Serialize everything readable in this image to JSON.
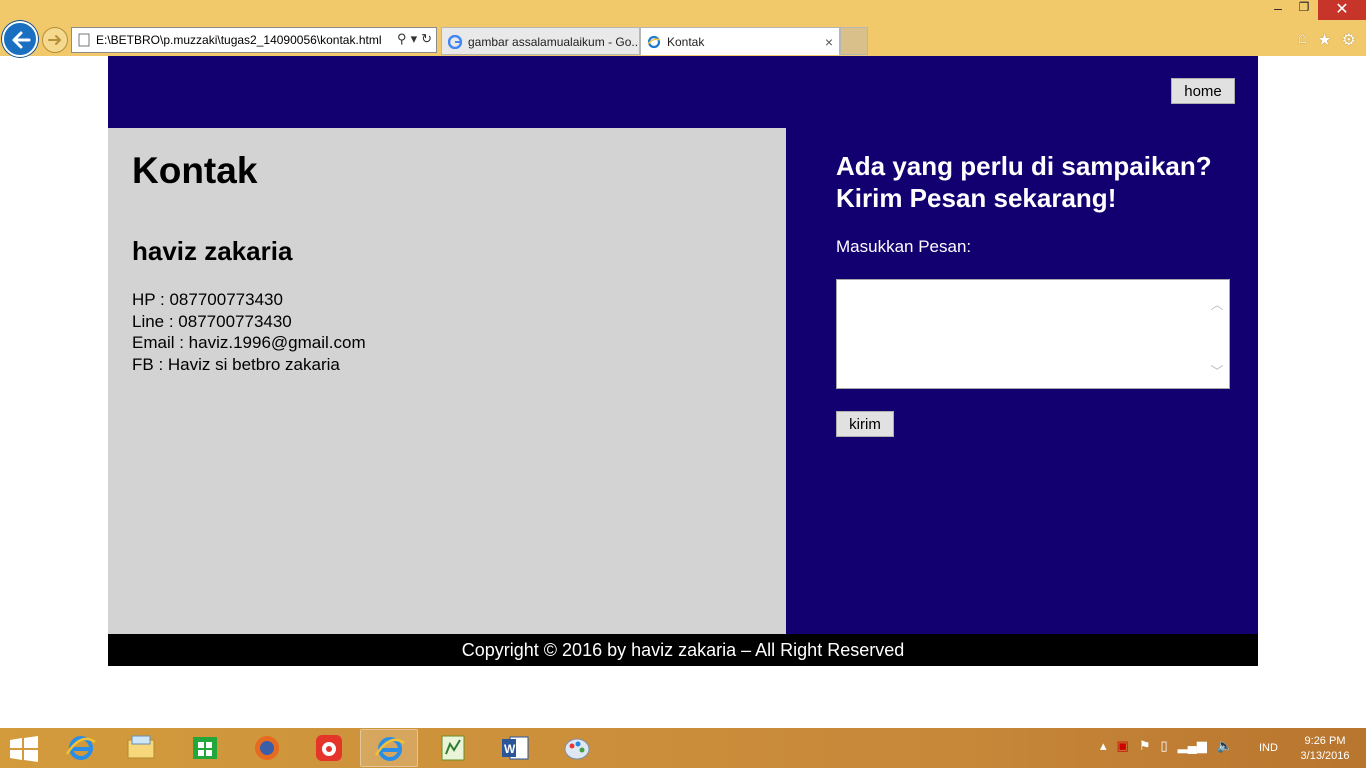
{
  "browser": {
    "address_url": "E:\\BETBRO\\p.muzzaki\\tugas2_14090056\\kontak.html",
    "tabs": [
      {
        "label": "gambar assalamualaikum - Go..."
      },
      {
        "label": "Kontak"
      }
    ],
    "tab_close_glyph": "×",
    "window_controls": {
      "minimize": "‒",
      "restore": "❐",
      "close": "✕"
    },
    "toolbar_icons": [
      "home-icon",
      "star-icon",
      "gear-icon"
    ]
  },
  "page": {
    "header": {
      "home_label": "home"
    },
    "left": {
      "title": "Kontak",
      "name": "haviz zakaria",
      "contacts": [
        "HP : 087700773430",
        "Line : 087700773430",
        "Email : haviz.1996@gmail.com",
        "FB : Haviz si betbro zakaria"
      ]
    },
    "right": {
      "heading": "Ada yang perlu di sampaikan? Kirim Pesan sekarang!",
      "message_label": "Masukkan Pesan:",
      "message_value": "",
      "submit_label": "kirim"
    },
    "footer": {
      "copyright": "Copyright © 2016 by haviz zakaria – All Right Reserved"
    },
    "colors": {
      "header_bg": "#120070",
      "left_bg": "#d3d3d3",
      "footer_bg": "#000000"
    }
  },
  "taskbar": {
    "apps": [
      "internet-explorer",
      "file-explorer",
      "store",
      "firefox",
      "app-red",
      "internet-explorer-open",
      "notepad-plus",
      "word",
      "paint"
    ],
    "language": "IND",
    "time": "9:26 PM",
    "date": "3/13/2016"
  }
}
